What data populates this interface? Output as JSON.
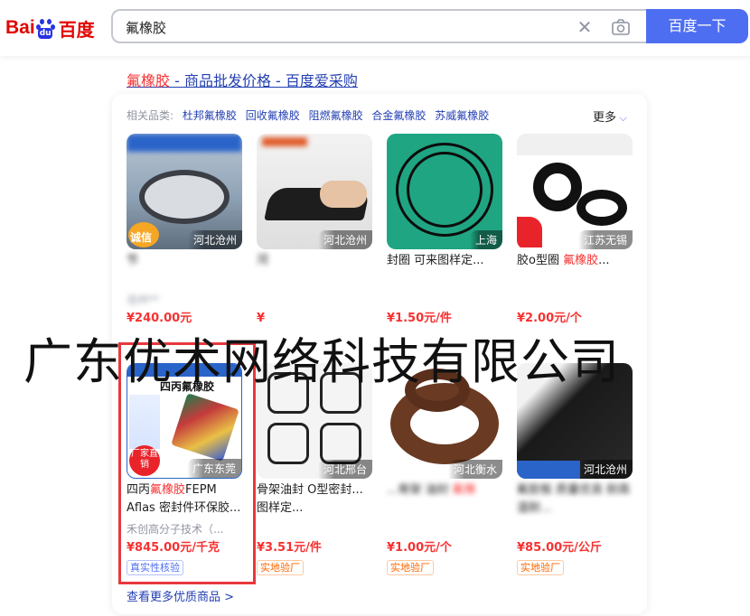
{
  "logo": {
    "bai": "Bai",
    "du": "du",
    "baidu_cn": "百度"
  },
  "search": {
    "query": "氟橡胶",
    "button_label": "百度一下"
  },
  "ad": {
    "kw": "氟橡胶",
    "rest": " - 商品批发价格 - 百度爱采购"
  },
  "related": {
    "label": "相关品类:",
    "items": [
      "杜邦氟橡胶",
      "回收氟橡胶",
      "阻燃氟橡胶",
      "合金氟橡胶",
      "苏威氟橡胶"
    ],
    "more": "更多"
  },
  "products": [
    {
      "location": "河北沧州",
      "title": "节",
      "company": "沧州**",
      "price": "¥240.00元",
      "badge": ""
    },
    {
      "location": "河北沧州",
      "title": "河",
      "company": "",
      "price": "¥",
      "badge": ""
    },
    {
      "location": "上海",
      "title": "封圈 可来图样定...",
      "company": "",
      "price": "¥1.50元/件",
      "badge": ""
    },
    {
      "location": "江苏无锡",
      "title": "胶o型圈 氟橡胶...",
      "title_kw": "氟橡胶",
      "company": "",
      "price": "¥2.00元/个",
      "badge": ""
    },
    {
      "location": "广东东莞",
      "title_pre": "四丙",
      "title_kw": "氟橡胶",
      "title_post": "FEPM Aflas 密封件环保胶...",
      "company": "禾创高分子技术（...",
      "price": "¥845.00元/千克",
      "badge": "真实性核验",
      "img_heading": "四丙氟橡胶",
      "img_tag": "厂家直销"
    },
    {
      "location": "河北邢台",
      "title": "骨架油封 O型密封...图样定...",
      "company": "",
      "price": "¥3.51元/件",
      "badge": "实地验厂"
    },
    {
      "location": "河北衡水",
      "title": "...骨架 油封",
      "title_kw": "氟橡",
      "company": "",
      "price": "¥1.00元/个",
      "badge": "实地验厂"
    },
    {
      "location": "河北沧州",
      "title": "氟胶板 质量优良 耐高温耐...",
      "company": "",
      "price": "¥85.00元/公斤",
      "badge": "实地验厂"
    }
  ],
  "see_more": "查看更多优质商品 >",
  "watermark": "广东优术网络科技有限公司",
  "colors": {
    "accent": "#4e6ef2",
    "keyword_red": "#f73131",
    "link_blue": "#2440b3",
    "box_red": "#e8383d"
  }
}
